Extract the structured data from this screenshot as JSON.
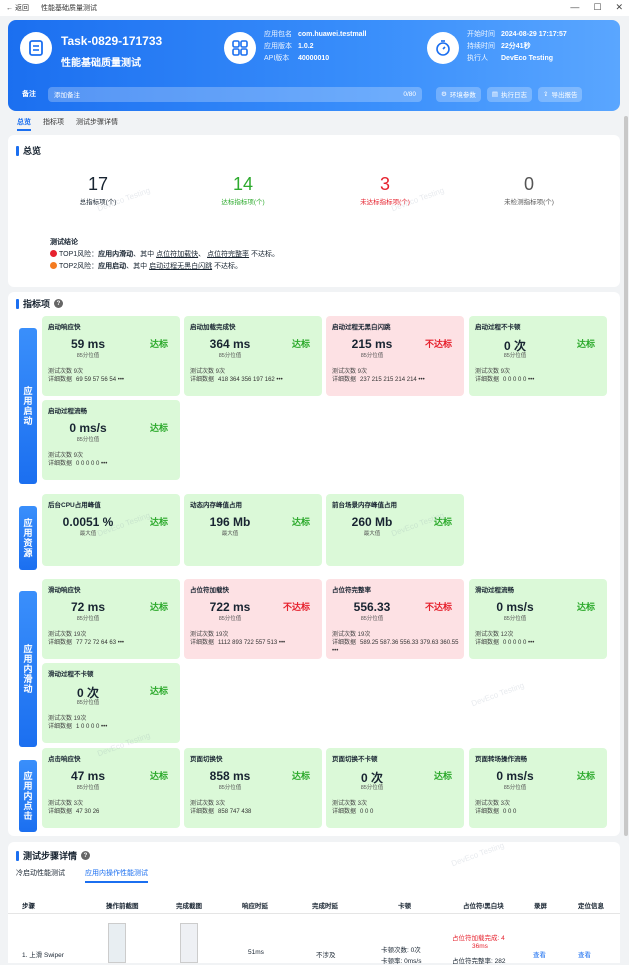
{
  "window": {
    "back_label": "返回",
    "title": "性能基础质量测试"
  },
  "header": {
    "task_id": "Task-0829-171733",
    "task_name": "性能基础质量测试",
    "app_package_label": "应用包名",
    "app_package": "com.huawei.testmall",
    "app_version_label": "应用版本",
    "app_version": "1.0.2",
    "api_label": "API版本",
    "api_version": "40000010",
    "start_label": "开始时间",
    "start_time": "2024-08-29 17:17:57",
    "duration_label": "持续时间",
    "duration": "22分41秒",
    "executor_label": "执行人",
    "executor": "DevEco Testing",
    "remark_label": "备注",
    "remark_placeholder": "添加备注",
    "remark_count": "0/80",
    "btn_env": "环境参数",
    "btn_log": "执行日志",
    "btn_export": "导出报告"
  },
  "tabs": [
    "总览",
    "指标项",
    "测试步骤详情"
  ],
  "overview": {
    "title": "总览",
    "stats": [
      {
        "num": "17",
        "label": "总指标项(个)",
        "color": "#182431"
      },
      {
        "num": "14",
        "label": "达标指标项(个)",
        "color": "#2daa2d"
      },
      {
        "num": "3",
        "label": "未达标指标项(个)",
        "color": "#e6222e"
      },
      {
        "num": "0",
        "label": "未检测指标项(个)",
        "color": "#555555"
      }
    ],
    "conclusion_title": "测试结论",
    "top1_prefix": "TOP1风险：",
    "top1_scene": "应用内滑动",
    "top1_mid": "、其中",
    "top1_item1": "点位符加载快",
    "top1_sep": "、",
    "top1_item2": "点位符完整率",
    "top1_suffix": "不达标。",
    "top2_prefix": "TOP2风险：",
    "top2_scene": "应用启动",
    "top2_mid": "、其中",
    "top2_item1": "启动过程无黑白闪跳",
    "top2_suffix": "不达标。"
  },
  "metrics_title": "指标项",
  "watermark": "DevEco Testing",
  "groups": [
    {
      "name": "应用启动",
      "cards": [
        {
          "title": "启动响应快",
          "value": "59 ms",
          "unit": "85分位值",
          "status": "达标",
          "ok": true,
          "count": "测试次数  9次",
          "detail": "69 59 57 56 54 •••"
        },
        {
          "title": "启动加载完成快",
          "value": "364 ms",
          "unit": "85分位值",
          "status": "达标",
          "ok": true,
          "count": "测试次数  9次",
          "detail": "418 364 356 197 162 •••"
        },
        {
          "title": "启动过程无黑白闪跳",
          "value": "215 ms",
          "unit": "85分位值",
          "status": "不达标",
          "ok": false,
          "count": "测试次数  9次",
          "detail": "237 215 215 214 214 •••"
        },
        {
          "title": "启动过程不卡顿",
          "value": "0 次",
          "unit": "85分位值",
          "status": "达标",
          "ok": true,
          "count": "测试次数  9次",
          "detail": "0 0 0 0 0 •••"
        },
        {
          "title": "启动过程流畅",
          "value": "0 ms/s",
          "unit": "85分位值",
          "status": "达标",
          "ok": true,
          "count": "测试次数  9次",
          "detail": "0 0 0 0 0 •••"
        }
      ]
    },
    {
      "name": "应用资源",
      "cards": [
        {
          "title": "后台CPU占用峰值",
          "value": "0.0051 %",
          "unit": "最大值",
          "status": "达标",
          "ok": true,
          "count": "",
          "detail": ""
        },
        {
          "title": "动态内存峰值占用",
          "value": "196 Mb",
          "unit": "最大值",
          "status": "达标",
          "ok": true,
          "count": "",
          "detail": ""
        },
        {
          "title": "前台场景内存峰值占用",
          "value": "260 Mb",
          "unit": "最大值",
          "status": "达标",
          "ok": true,
          "count": "",
          "detail": ""
        }
      ]
    },
    {
      "name": "应用内滑动",
      "cards": [
        {
          "title": "滑动响应快",
          "value": "72 ms",
          "unit": "85分位值",
          "status": "达标",
          "ok": true,
          "count": "测试次数  19次",
          "detail": "77 72 72 64 63 •••"
        },
        {
          "title": "占位符加载快",
          "value": "722 ms",
          "unit": "85分位值",
          "status": "不达标",
          "ok": false,
          "count": "测试次数  19次",
          "detail": "1112 893 722 557 513 •••"
        },
        {
          "title": "占位符完整率",
          "value": "556.33",
          "unit": "85分位值",
          "status": "不达标",
          "ok": false,
          "count": "测试次数  19次",
          "detail": "589.25 587.36 556.33 379.63 360.55 •••"
        },
        {
          "title": "滑动过程流畅",
          "value": "0 ms/s",
          "unit": "85分位值",
          "status": "达标",
          "ok": true,
          "count": "测试次数  12次",
          "detail": "0 0 0 0 0 •••"
        },
        {
          "title": "滑动过程不卡顿",
          "value": "0 次",
          "unit": "85分位值",
          "status": "达标",
          "ok": true,
          "count": "测试次数  19次",
          "detail": "1 0 0 0 0 •••"
        }
      ]
    },
    {
      "name": "应用内点击",
      "cards": [
        {
          "title": "点击响应快",
          "value": "47 ms",
          "unit": "85分位值",
          "status": "达标",
          "ok": true,
          "count": "测试次数  3次",
          "detail": "47 30 26"
        },
        {
          "title": "页面切换快",
          "value": "858 ms",
          "unit": "85分位值",
          "status": "达标",
          "ok": true,
          "count": "测试次数  3次",
          "detail": "858 747 438"
        },
        {
          "title": "页面切换不卡顿",
          "value": "0 次",
          "unit": "85分位值",
          "status": "达标",
          "ok": true,
          "count": "测试次数  3次",
          "detail": "0 0 0"
        },
        {
          "title": "页面转场操作流畅",
          "value": "0 ms/s",
          "unit": "85分位值",
          "status": "达标",
          "ok": true,
          "count": "测试次数  3次",
          "detail": "0 0 0"
        }
      ]
    }
  ],
  "detail_label": "详细数据",
  "steps": {
    "title": "测试步骤详情",
    "subtabs": [
      "冷启动性能测试",
      "应用内操作性能测试"
    ],
    "columns": [
      "步骤",
      "操作前截图",
      "完成截图",
      "响应时延",
      "完成时延",
      "卡顿",
      "占位符/黑白块",
      "录屏",
      "定位信息"
    ],
    "row": {
      "step": "1. 上滑 Swiper",
      "response": "51ms",
      "complete": "不涉及",
      "jank1": "卡顿次数: 0次",
      "jank2": "卡顿率: 0ms/s",
      "ph1": "占位符加载完成: 4",
      "ph2": "36ms",
      "ph3": "占位符完整率: 282",
      "rec": "查看",
      "loc": "查看"
    }
  }
}
